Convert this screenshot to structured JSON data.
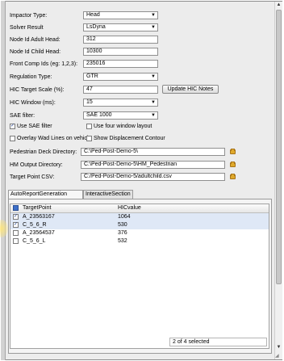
{
  "form": {
    "impactor_type": {
      "label": "Impactor Type:",
      "value": "Head"
    },
    "solver_result": {
      "label": "Solver Result",
      "value": "LsDyna"
    },
    "node_id_adult": {
      "label": "Node Id Adult Head:",
      "value": "312"
    },
    "node_id_child": {
      "label": "Node Id Child Head:",
      "value": "10300"
    },
    "front_comp_ids": {
      "label": "Front Comp Ids (eg: 1,2,3):",
      "value": "235016"
    },
    "regulation_type": {
      "label": "Regulation Type:",
      "value": "GTR"
    },
    "hic_target_scale": {
      "label": "HIC Target Scale (%):",
      "value": "47"
    },
    "update_hic_notes": "Update HIC Notes",
    "hic_window": {
      "label": "HIC Window (ms):",
      "value": "15"
    },
    "sae_filter": {
      "label": "SAE filter:",
      "value": "SAE 1000"
    },
    "use_sae_filter": {
      "label": "Use SAE filter",
      "checked": true
    },
    "use_four_window": {
      "label": "Use four window layout",
      "checked": false
    },
    "overlay_wad": {
      "label": "Overlay Wad Lines on vehicle",
      "checked": false
    },
    "show_displacement": {
      "label": "Show Displacement Contour",
      "checked": false
    },
    "ped_deck_dir": {
      "label": "Pedestrian Deck Directory:",
      "value": "C:\\Ped-Post-Demo-5\\"
    },
    "hm_output_dir": {
      "label": "HM Output Directory:",
      "value": "C:\\Ped-Post-Demo-5\\HM_Pedestrian"
    },
    "target_csv": {
      "label": "Target Point CSV:",
      "value": "C:/Ped-Post-Demo-5/adultchild.csv"
    }
  },
  "tabs": [
    {
      "label": "AutoReportGeneration"
    },
    {
      "label": "InteractiveSection"
    }
  ],
  "table": {
    "headers": [
      "TargetPoint",
      "HICvalue"
    ],
    "rows": [
      {
        "target": "A_23563167",
        "hic": "1064",
        "checked": true
      },
      {
        "target": "C_5_6_R",
        "hic": "530",
        "checked": true
      },
      {
        "target": "A_23564537",
        "hic": "376",
        "checked": false
      },
      {
        "target": "C_5_6_L",
        "hic": "532",
        "checked": false
      }
    ]
  },
  "status": {
    "text": "2 of 4 selected"
  }
}
